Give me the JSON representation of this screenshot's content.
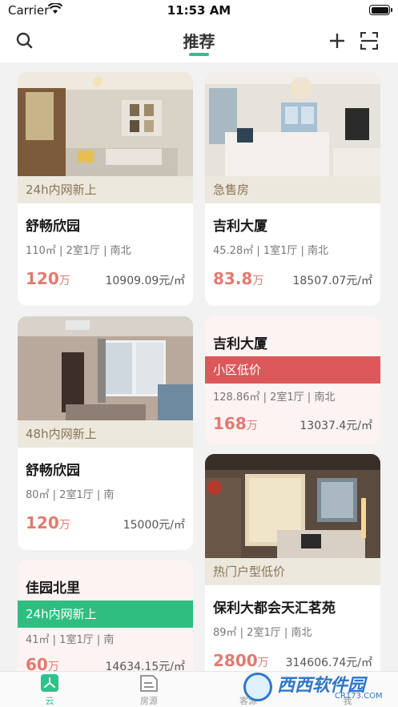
{
  "status_bar": {
    "carrier": "Carrier",
    "time": "11:53 AM"
  },
  "nav": {
    "title": "推荐"
  },
  "listings": [
    {
      "tag": "24h内网新上",
      "name": "舒畅欣园",
      "spec": "110㎡ | 2室1厅 | 南北",
      "price": "120",
      "price_unit": "万",
      "unit_price": "10909.09元/㎡"
    },
    {
      "tag": "急售房",
      "name": "吉利大厦",
      "spec": "45.28㎡ | 1室1厅 | 南北",
      "price": "83.8",
      "price_unit": "万",
      "unit_price": "18507.07元/㎡"
    },
    {
      "tag": "48h内网新上",
      "name": "舒畅欣园",
      "spec": "80㎡ | 2室1厅 | 南",
      "price": "120",
      "price_unit": "万",
      "unit_price": "15000元/㎡"
    },
    {
      "tag": "小区低价",
      "name": "吉利大厦",
      "spec": "128.86㎡ | 2室1厅 | 南北",
      "price": "168",
      "price_unit": "万",
      "unit_price": "13037.4元/㎡"
    },
    {
      "tag": "热门户型低价",
      "name": "保利大都会天汇茗苑",
      "spec": "89㎡ | 2室1厅 | 南北",
      "price": "2800",
      "price_unit": "万",
      "unit_price": "314606.74元/㎡"
    },
    {
      "tag": "24h内网新上",
      "name": "佳园北里",
      "spec": "41㎡ | 1室1厅 | 南",
      "price": "60",
      "price_unit": "万",
      "unit_price": "14634.15元/㎡"
    }
  ],
  "tabbar": {
    "tabs": [
      "云",
      "房源",
      "客源",
      "我"
    ],
    "active": "云"
  },
  "watermark": {
    "brand": "西西软件园",
    "url": "CR173.COM"
  },
  "icons": [
    "wifi-icon",
    "battery-icon",
    "search-icon",
    "plus-icon",
    "scan-icon",
    "cloud-tab-icon",
    "listing-tab-icon"
  ],
  "colors": {
    "accent": "#2fc28a",
    "price": "#e07b70",
    "tag_beige": "#ece8dd",
    "tag_red": "#dc585a",
    "tag_green": "#2fbd80"
  }
}
